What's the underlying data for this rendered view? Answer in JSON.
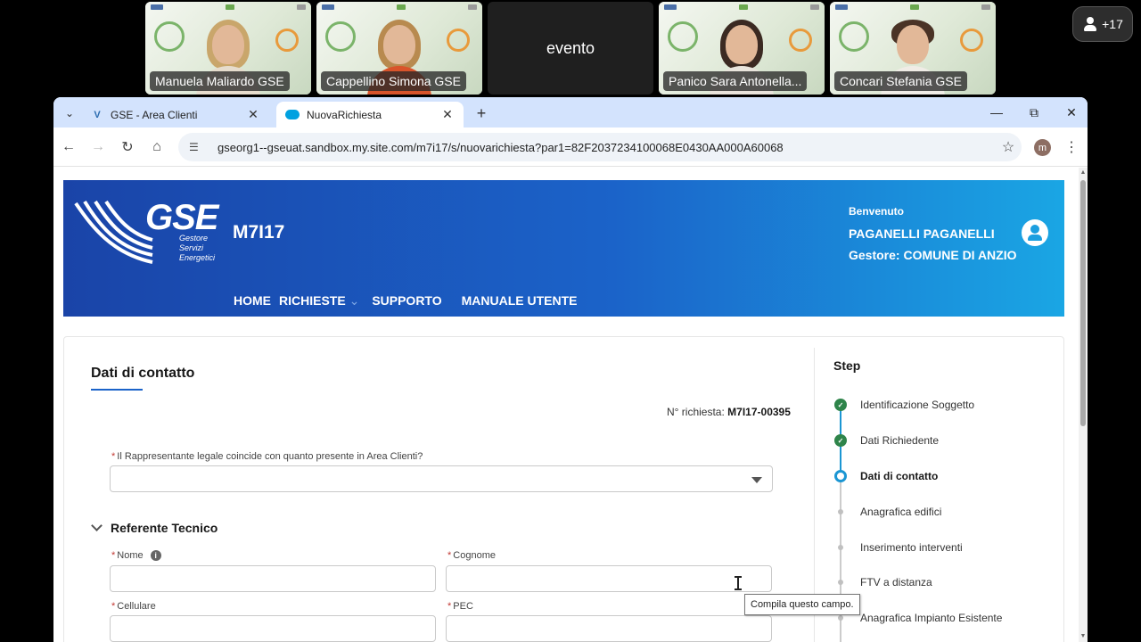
{
  "meeting": {
    "participants": [
      {
        "name": "Manuela Maliardo GSE"
      },
      {
        "name": "Cappellino Simona GSE"
      },
      {
        "name": "evento"
      },
      {
        "name": "Panico Sara Antonella..."
      },
      {
        "name": "Concari Stefania GSE"
      }
    ],
    "more_count": "+17"
  },
  "browser": {
    "tabs": [
      {
        "label": "GSE - Area Clienti"
      },
      {
        "label": "NuovaRichiesta"
      }
    ],
    "url": "gseorg1--gseuat.sandbox.my.site.com/m7i17/s/nuovarichiesta?par1=82F2037234100068E0430AA000A60068",
    "profile_initial": "m"
  },
  "site": {
    "logo_text": "GSE",
    "logo_sub": "Gestore Servizi Energetici",
    "app_name": "M7I17",
    "menu": [
      "HOME",
      "RICHIESTE",
      "SUPPORTO",
      "MANUALE UTENTE"
    ],
    "welcome": "Benvenuto",
    "user": "PAGANELLI PAGANELLI",
    "manager": "Gestore: COMUNE DI ANZIO"
  },
  "form": {
    "section_title": "Dati di contatto",
    "request_label": "N° richiesta:",
    "request_number": "M7I17-00395",
    "question": "Il Rappresentante legale coincide con quanto presente in Area Clienti?",
    "subsection": "Referente Tecnico",
    "fields": {
      "nome": "Nome",
      "cognome": "Cognome",
      "cellulare": "Cellulare",
      "pec": "PEC"
    },
    "required_mark": "*"
  },
  "steps": {
    "title": "Step",
    "items": [
      {
        "label": "Identificazione Soggetto",
        "status": "done"
      },
      {
        "label": "Dati Richiedente",
        "status": "done"
      },
      {
        "label": "Dati di contatto",
        "status": "current"
      },
      {
        "label": "Anagrafica edifici",
        "status": "todo"
      },
      {
        "label": "Inserimento interventi",
        "status": "todo"
      },
      {
        "label": "FTV a distanza",
        "status": "todo"
      },
      {
        "label": "Anagrafica Impianto Esistente",
        "status": "todo"
      }
    ]
  },
  "tooltip": "Compila questo campo.",
  "colors": {
    "banner_start": "#1a44a8",
    "banner_end": "#1aa6e4",
    "step_done": "#2e844a",
    "step_current": "#1b96d3",
    "required": "#c23934"
  },
  "icons": {
    "more_participants": "person-icon",
    "new_tab": "plus-icon",
    "bookmark": "star-icon"
  }
}
